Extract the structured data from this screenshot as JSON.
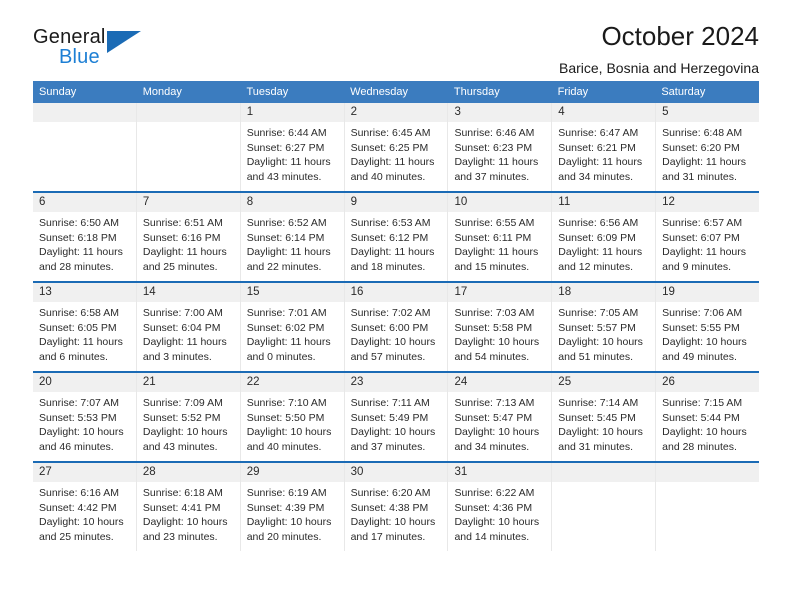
{
  "brand": {
    "name_part1": "General",
    "name_part2": "Blue",
    "triangle_color": "#1b6bb5",
    "blue_text_color": "#1d7fd4"
  },
  "header": {
    "title": "October 2024",
    "subtitle": "Barice, Bosnia and Herzegovina"
  },
  "theme": {
    "header_bar": "#3b7cbf",
    "row_divider": "#1b6bb5",
    "daynum_band": "#f0f0f0",
    "text": "#2b2b2b"
  },
  "labels": {
    "sunrise_prefix": "Sunrise:",
    "sunset_prefix": "Sunset:",
    "daylight_prefix": "Daylight:"
  },
  "weekdays": [
    "Sunday",
    "Monday",
    "Tuesday",
    "Wednesday",
    "Thursday",
    "Friday",
    "Saturday"
  ],
  "weeks": [
    [
      {
        "day": "",
        "sunrise": "",
        "sunset": "",
        "daylight_line1": "",
        "daylight_line2": ""
      },
      {
        "day": "",
        "sunrise": "",
        "sunset": "",
        "daylight_line1": "",
        "daylight_line2": ""
      },
      {
        "day": "1",
        "sunrise": "Sunrise: 6:44 AM",
        "sunset": "Sunset: 6:27 PM",
        "daylight_line1": "Daylight: 11 hours",
        "daylight_line2": "and 43 minutes."
      },
      {
        "day": "2",
        "sunrise": "Sunrise: 6:45 AM",
        "sunset": "Sunset: 6:25 PM",
        "daylight_line1": "Daylight: 11 hours",
        "daylight_line2": "and 40 minutes."
      },
      {
        "day": "3",
        "sunrise": "Sunrise: 6:46 AM",
        "sunset": "Sunset: 6:23 PM",
        "daylight_line1": "Daylight: 11 hours",
        "daylight_line2": "and 37 minutes."
      },
      {
        "day": "4",
        "sunrise": "Sunrise: 6:47 AM",
        "sunset": "Sunset: 6:21 PM",
        "daylight_line1": "Daylight: 11 hours",
        "daylight_line2": "and 34 minutes."
      },
      {
        "day": "5",
        "sunrise": "Sunrise: 6:48 AM",
        "sunset": "Sunset: 6:20 PM",
        "daylight_line1": "Daylight: 11 hours",
        "daylight_line2": "and 31 minutes."
      }
    ],
    [
      {
        "day": "6",
        "sunrise": "Sunrise: 6:50 AM",
        "sunset": "Sunset: 6:18 PM",
        "daylight_line1": "Daylight: 11 hours",
        "daylight_line2": "and 28 minutes."
      },
      {
        "day": "7",
        "sunrise": "Sunrise: 6:51 AM",
        "sunset": "Sunset: 6:16 PM",
        "daylight_line1": "Daylight: 11 hours",
        "daylight_line2": "and 25 minutes."
      },
      {
        "day": "8",
        "sunrise": "Sunrise: 6:52 AM",
        "sunset": "Sunset: 6:14 PM",
        "daylight_line1": "Daylight: 11 hours",
        "daylight_line2": "and 22 minutes."
      },
      {
        "day": "9",
        "sunrise": "Sunrise: 6:53 AM",
        "sunset": "Sunset: 6:12 PM",
        "daylight_line1": "Daylight: 11 hours",
        "daylight_line2": "and 18 minutes."
      },
      {
        "day": "10",
        "sunrise": "Sunrise: 6:55 AM",
        "sunset": "Sunset: 6:11 PM",
        "daylight_line1": "Daylight: 11 hours",
        "daylight_line2": "and 15 minutes."
      },
      {
        "day": "11",
        "sunrise": "Sunrise: 6:56 AM",
        "sunset": "Sunset: 6:09 PM",
        "daylight_line1": "Daylight: 11 hours",
        "daylight_line2": "and 12 minutes."
      },
      {
        "day": "12",
        "sunrise": "Sunrise: 6:57 AM",
        "sunset": "Sunset: 6:07 PM",
        "daylight_line1": "Daylight: 11 hours",
        "daylight_line2": "and 9 minutes."
      }
    ],
    [
      {
        "day": "13",
        "sunrise": "Sunrise: 6:58 AM",
        "sunset": "Sunset: 6:05 PM",
        "daylight_line1": "Daylight: 11 hours",
        "daylight_line2": "and 6 minutes."
      },
      {
        "day": "14",
        "sunrise": "Sunrise: 7:00 AM",
        "sunset": "Sunset: 6:04 PM",
        "daylight_line1": "Daylight: 11 hours",
        "daylight_line2": "and 3 minutes."
      },
      {
        "day": "15",
        "sunrise": "Sunrise: 7:01 AM",
        "sunset": "Sunset: 6:02 PM",
        "daylight_line1": "Daylight: 11 hours",
        "daylight_line2": "and 0 minutes."
      },
      {
        "day": "16",
        "sunrise": "Sunrise: 7:02 AM",
        "sunset": "Sunset: 6:00 PM",
        "daylight_line1": "Daylight: 10 hours",
        "daylight_line2": "and 57 minutes."
      },
      {
        "day": "17",
        "sunrise": "Sunrise: 7:03 AM",
        "sunset": "Sunset: 5:58 PM",
        "daylight_line1": "Daylight: 10 hours",
        "daylight_line2": "and 54 minutes."
      },
      {
        "day": "18",
        "sunrise": "Sunrise: 7:05 AM",
        "sunset": "Sunset: 5:57 PM",
        "daylight_line1": "Daylight: 10 hours",
        "daylight_line2": "and 51 minutes."
      },
      {
        "day": "19",
        "sunrise": "Sunrise: 7:06 AM",
        "sunset": "Sunset: 5:55 PM",
        "daylight_line1": "Daylight: 10 hours",
        "daylight_line2": "and 49 minutes."
      }
    ],
    [
      {
        "day": "20",
        "sunrise": "Sunrise: 7:07 AM",
        "sunset": "Sunset: 5:53 PM",
        "daylight_line1": "Daylight: 10 hours",
        "daylight_line2": "and 46 minutes."
      },
      {
        "day": "21",
        "sunrise": "Sunrise: 7:09 AM",
        "sunset": "Sunset: 5:52 PM",
        "daylight_line1": "Daylight: 10 hours",
        "daylight_line2": "and 43 minutes."
      },
      {
        "day": "22",
        "sunrise": "Sunrise: 7:10 AM",
        "sunset": "Sunset: 5:50 PM",
        "daylight_line1": "Daylight: 10 hours",
        "daylight_line2": "and 40 minutes."
      },
      {
        "day": "23",
        "sunrise": "Sunrise: 7:11 AM",
        "sunset": "Sunset: 5:49 PM",
        "daylight_line1": "Daylight: 10 hours",
        "daylight_line2": "and 37 minutes."
      },
      {
        "day": "24",
        "sunrise": "Sunrise: 7:13 AM",
        "sunset": "Sunset: 5:47 PM",
        "daylight_line1": "Daylight: 10 hours",
        "daylight_line2": "and 34 minutes."
      },
      {
        "day": "25",
        "sunrise": "Sunrise: 7:14 AM",
        "sunset": "Sunset: 5:45 PM",
        "daylight_line1": "Daylight: 10 hours",
        "daylight_line2": "and 31 minutes."
      },
      {
        "day": "26",
        "sunrise": "Sunrise: 7:15 AM",
        "sunset": "Sunset: 5:44 PM",
        "daylight_line1": "Daylight: 10 hours",
        "daylight_line2": "and 28 minutes."
      }
    ],
    [
      {
        "day": "27",
        "sunrise": "Sunrise: 6:16 AM",
        "sunset": "Sunset: 4:42 PM",
        "daylight_line1": "Daylight: 10 hours",
        "daylight_line2": "and 25 minutes."
      },
      {
        "day": "28",
        "sunrise": "Sunrise: 6:18 AM",
        "sunset": "Sunset: 4:41 PM",
        "daylight_line1": "Daylight: 10 hours",
        "daylight_line2": "and 23 minutes."
      },
      {
        "day": "29",
        "sunrise": "Sunrise: 6:19 AM",
        "sunset": "Sunset: 4:39 PM",
        "daylight_line1": "Daylight: 10 hours",
        "daylight_line2": "and 20 minutes."
      },
      {
        "day": "30",
        "sunrise": "Sunrise: 6:20 AM",
        "sunset": "Sunset: 4:38 PM",
        "daylight_line1": "Daylight: 10 hours",
        "daylight_line2": "and 17 minutes."
      },
      {
        "day": "31",
        "sunrise": "Sunrise: 6:22 AM",
        "sunset": "Sunset: 4:36 PM",
        "daylight_line1": "Daylight: 10 hours",
        "daylight_line2": "and 14 minutes."
      },
      {
        "day": "",
        "sunrise": "",
        "sunset": "",
        "daylight_line1": "",
        "daylight_line2": ""
      },
      {
        "day": "",
        "sunrise": "",
        "sunset": "",
        "daylight_line1": "",
        "daylight_line2": ""
      }
    ]
  ]
}
